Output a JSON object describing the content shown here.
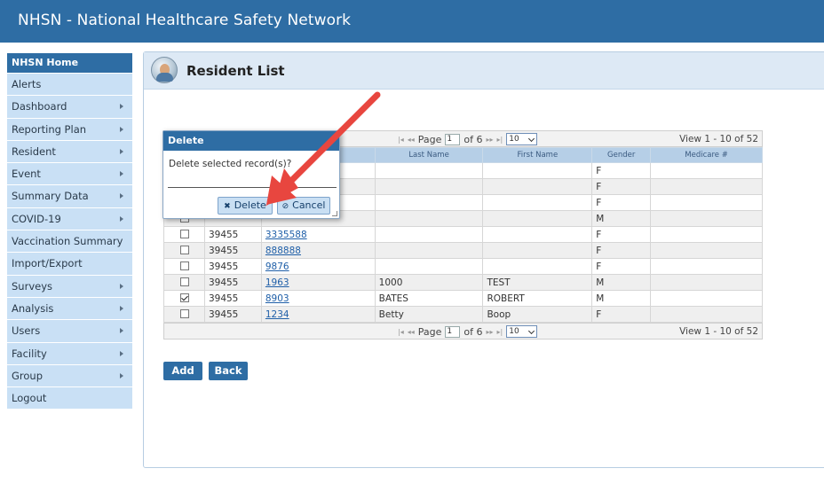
{
  "app": {
    "title": "NHSN - National Healthcare Safety Network"
  },
  "sidebar": {
    "items": [
      {
        "label": "NHSN Home",
        "submenu": false,
        "active": true
      },
      {
        "label": "Alerts",
        "submenu": false
      },
      {
        "label": "Dashboard",
        "submenu": true
      },
      {
        "label": "Reporting Plan",
        "submenu": true
      },
      {
        "label": "Resident",
        "submenu": true
      },
      {
        "label": "Event",
        "submenu": true
      },
      {
        "label": "Summary Data",
        "submenu": true
      },
      {
        "label": "COVID-19",
        "submenu": true
      },
      {
        "label": "Vaccination Summary",
        "submenu": false
      },
      {
        "label": "Import/Export",
        "submenu": false
      },
      {
        "label": "Surveys",
        "submenu": true
      },
      {
        "label": "Analysis",
        "submenu": true
      },
      {
        "label": "Users",
        "submenu": true
      },
      {
        "label": "Facility",
        "submenu": true
      },
      {
        "label": "Group",
        "submenu": true
      },
      {
        "label": "Logout",
        "submenu": false
      }
    ]
  },
  "page": {
    "title": "Resident List"
  },
  "grid": {
    "pager": {
      "page_label": "Page",
      "page_value": "1",
      "of_label": "of 6",
      "page_size": "10",
      "view_text": "View 1 - 10 of 52"
    },
    "columns": [
      "",
      "",
      "",
      "Last Name",
      "First Name",
      "Gender",
      "Medicare #"
    ],
    "rows": [
      {
        "checked": false,
        "facility": "",
        "resident_id": "",
        "last": "",
        "first": "",
        "gender": "F",
        "medicare": ""
      },
      {
        "checked": false,
        "facility": "",
        "resident_id": "",
        "last": "",
        "first": "",
        "gender": "F",
        "medicare": ""
      },
      {
        "checked": false,
        "facility": "",
        "resident_id": "",
        "last": "",
        "first": "",
        "gender": "F",
        "medicare": ""
      },
      {
        "checked": false,
        "facility": "",
        "resident_id": "",
        "last": "",
        "first": "",
        "gender": "M",
        "medicare": ""
      },
      {
        "checked": false,
        "facility": "39455",
        "resident_id": "3335588",
        "last": "",
        "first": "",
        "gender": "F",
        "medicare": ""
      },
      {
        "checked": false,
        "facility": "39455",
        "resident_id": "888888",
        "last": "",
        "first": "",
        "gender": "F",
        "medicare": ""
      },
      {
        "checked": false,
        "facility": "39455",
        "resident_id": "9876",
        "last": "",
        "first": "",
        "gender": "F",
        "medicare": ""
      },
      {
        "checked": false,
        "facility": "39455",
        "resident_id": "1963",
        "last": "1000",
        "first": "TEST",
        "gender": "M",
        "medicare": ""
      },
      {
        "checked": true,
        "facility": "39455",
        "resident_id": "8903",
        "last": "BATES",
        "first": "ROBERT",
        "gender": "M",
        "medicare": ""
      },
      {
        "checked": false,
        "facility": "39455",
        "resident_id": "1234",
        "last": "Betty",
        "first": "Boop",
        "gender": "F",
        "medicare": ""
      }
    ]
  },
  "buttons": {
    "add": "Add",
    "back": "Back"
  },
  "dialog": {
    "title": "Delete",
    "message": "Delete selected record(s)?",
    "delete_label": "Delete",
    "cancel_label": "Cancel"
  },
  "colors": {
    "brand": "#2e6da4",
    "sidebar_bg": "#c9e0f5",
    "annotation_arrow": "#e8463f"
  },
  "icons": {
    "pager_first": "first-page-icon",
    "pager_prev": "prev-page-icon",
    "pager_next": "next-page-icon",
    "pager_last": "last-page-icon",
    "delete": "delete-icon",
    "cancel": "cancel-icon"
  }
}
